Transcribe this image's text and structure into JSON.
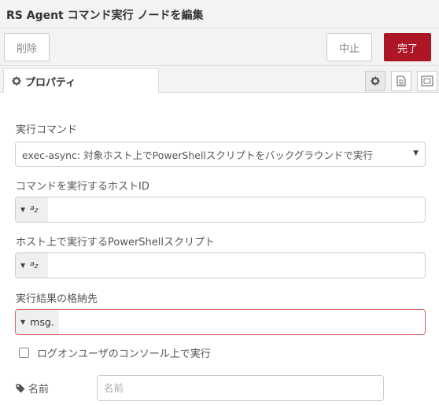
{
  "dialog": {
    "title": "RS Agent コマンド実行 ノードを編集"
  },
  "toolbar": {
    "delete_label": "削除",
    "cancel_label": "中止",
    "done_label": "完了"
  },
  "tabs": {
    "properties_label": "プロパティ"
  },
  "form": {
    "command_label": "実行コマンド",
    "command_value": "exec-async: 対象ホスト上でPowerShellスクリプトをバックグラウンドで実行",
    "host_id_label": "コマンドを実行するホストID",
    "host_id_type": "a z",
    "host_id_value": "",
    "script_label": "ホスト上で実行するPowerShellスクリプト",
    "script_type": "a z",
    "script_value": "",
    "result_label": "実行結果の格納先",
    "result_type": "msg.",
    "result_value": "",
    "console_checkbox_label": "ログオンユーザのコンソール上で実行",
    "console_checked": false,
    "name_label": "名前",
    "name_placeholder": "名前",
    "name_value": ""
  },
  "colors": {
    "accent": "#ad1625",
    "error_border": "#d6615f",
    "header_bg": "#f3f3f3"
  },
  "icons": {
    "tab_properties": "gear-icon",
    "tab_settings": "gear-icon",
    "tab_description": "document-icon",
    "tab_appearance": "frame-icon",
    "name": "tag-icon",
    "dropdown": "caret-down-icon"
  }
}
